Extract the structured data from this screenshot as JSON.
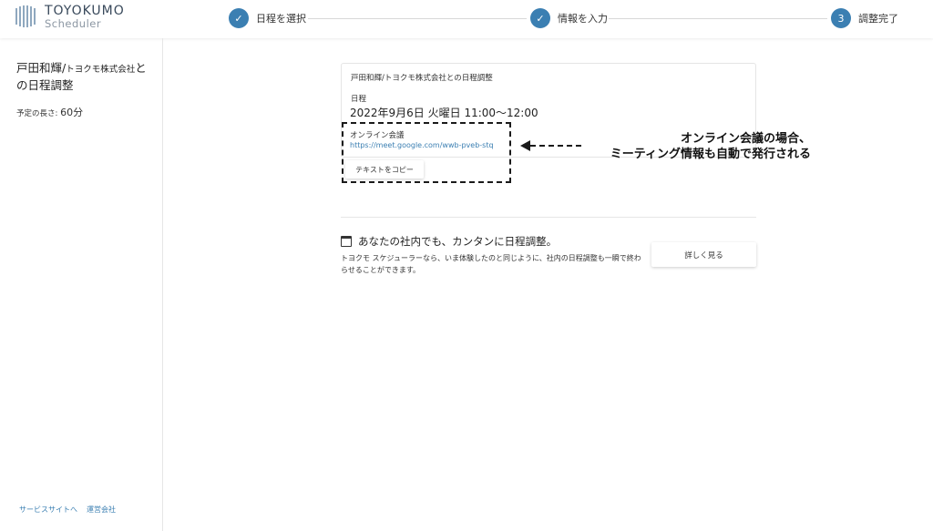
{
  "brand": {
    "name": "TOYOKUMO",
    "sub": "Scheduler"
  },
  "steps": [
    {
      "label": "日程を選択",
      "marker": "✓",
      "status": "done"
    },
    {
      "label": "情報を入力",
      "marker": "✓",
      "status": "done"
    },
    {
      "label": "調整完了",
      "marker": "3",
      "status": "current"
    }
  ],
  "sidebar": {
    "title_main": "戸田和輝/",
    "title_company": "トヨクモ株式会社",
    "title_suffix": "との日程調整",
    "duration_label": "予定の長さ:",
    "duration_value": "60分",
    "footer_links": [
      "サービスサイトへ",
      "運営会社"
    ]
  },
  "card": {
    "title": "戸田和輝/トヨクモ株式会社との日程調整",
    "date_label": "日程",
    "date_value": "2022年9月6日 火曜日 11:00〜12:00",
    "online_label": "オンライン会議",
    "online_url": "https://meet.google.com/wwb-pveb-stq",
    "copy_button": "テキストをコピー"
  },
  "annotation": {
    "line1": "オンライン会議の場合、",
    "line2": "ミーティング情報も自動で発行される"
  },
  "promo": {
    "title": "あなたの社内でも、カンタンに日程調整。",
    "text": "トヨクモ スケジューラーなら、いま体験したのと同じように、社内の日程調整も一瞬で終わらせることができます。",
    "button": "詳しく見る"
  },
  "colors": {
    "accent": "#3b7fb2"
  }
}
